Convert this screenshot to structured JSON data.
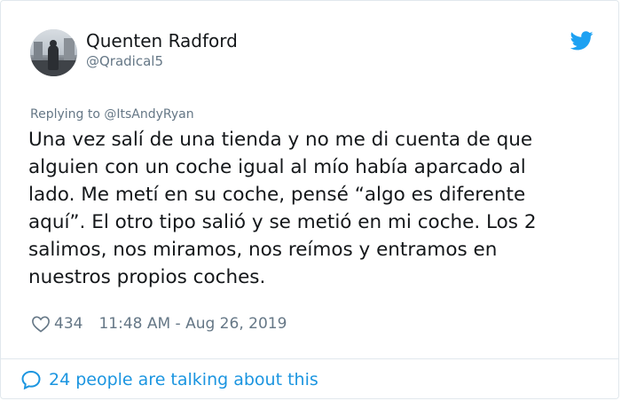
{
  "tweet": {
    "author": {
      "name": "Quenten Radford",
      "handle": "@Qradical5"
    },
    "replying_to": "Replying to @ItsAndyRyan",
    "text": "Una vez salí de una tienda y no me di cuenta de que\nalguien con un coche igual al mío había aparcado al\nlado. Me metí en su coche, pensé “algo es diferente\naquí”. El otro tipo salió y se metió en mi coche. Los 2\nsalimos, nos miramos, nos reímos y entramos en\nnuestros propios coches.",
    "likes": "434",
    "timestamp": "11:48 AM - Aug 26, 2019",
    "footer": "24 people are talking about this"
  },
  "icons": {
    "brand": "twitter-bird-icon",
    "like": "heart-icon",
    "conversation": "speech-bubble-icon"
  },
  "colors": {
    "accent": "#1da1f2",
    "link": "#1b95e0",
    "muted": "#657786",
    "text": "#14171a",
    "border": "#e1e8ed"
  }
}
